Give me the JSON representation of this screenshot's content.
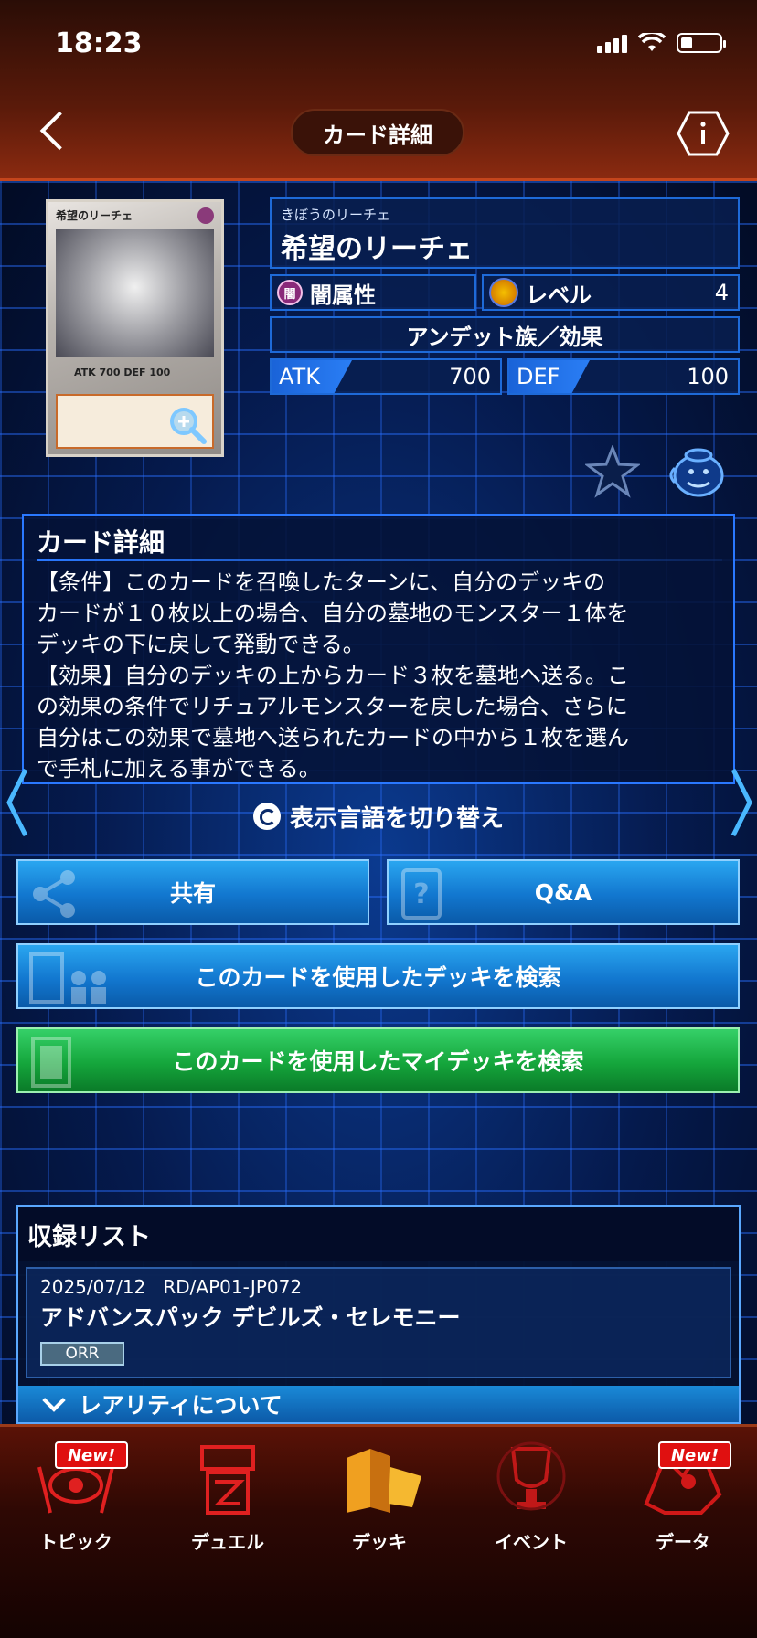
{
  "status": {
    "time": "18:23"
  },
  "header": {
    "title": "カード詳細"
  },
  "card": {
    "image_name": "希望のリーチェ",
    "image_atk": "700",
    "image_def": "100",
    "ruby": "きぼうのリーチェ",
    "name": "希望のリーチェ",
    "attribute": "闇属性",
    "attribute_badge": "闇",
    "level_label": "レベル",
    "level": "4",
    "type": "アンデット族／効果",
    "atk_label": "ATK",
    "atk": "700",
    "def_label": "DEF",
    "def": "100"
  },
  "detail": {
    "title": "カード詳細",
    "text": "【条件】このカードを召喚したターンに、自分のデッキの\nカードが１０枚以上の場合、自分の墓地のモンスター１体を\nデッキの下に戻して発動できる。\n【効果】自分のデッキの上からカード３枚を墓地へ送る。こ\nの効果の条件でリチュアルモンスターを戻した場合、さらに\n自分はこの効果で墓地へ送られたカードの中から１枚を選ん\nで手札に加える事ができる。",
    "lang_switch": "表示言語を切り替え"
  },
  "buttons": {
    "share": "共有",
    "qa": "Q&A",
    "search_decks": "このカードを使用したデッキを検索",
    "search_my_decks": "このカードを使用したマイデッキを検索"
  },
  "release": {
    "title": "収録リスト",
    "items": [
      {
        "date": "2025/07/12",
        "code": "RD/AP01-JP072",
        "name": "アドバンスパック デビルズ・セレモニー",
        "rarity": "ORR"
      }
    ],
    "rarity_toggle": "レアリティについて"
  },
  "tabs": [
    {
      "label": "トピック",
      "badge": "New!"
    },
    {
      "label": "デュエル"
    },
    {
      "label": "デッキ"
    },
    {
      "label": "イベント"
    },
    {
      "label": "データ",
      "badge": "New!"
    }
  ],
  "colors": {
    "accent": "#1e6ad8",
    "topbar": "#5a1a0a",
    "green": "#15a63c"
  }
}
